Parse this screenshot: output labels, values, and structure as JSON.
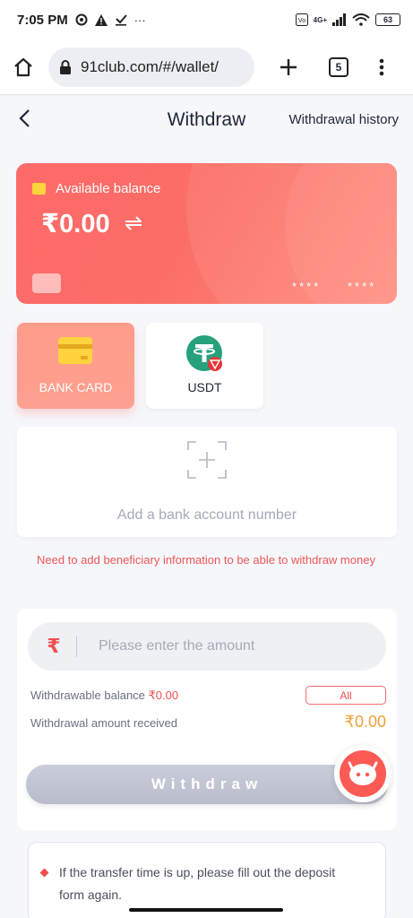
{
  "status_bar": {
    "time": "7:05 PM",
    "network": "4G+",
    "battery": "63",
    "notification_icons": [
      "sync-icon",
      "warning-icon",
      "check-icon",
      "more-dots-icon"
    ]
  },
  "browser": {
    "url": "91club.com/#/wallet/",
    "tab_count": "5",
    "icons": [
      "home-icon",
      "lock-icon",
      "new-tab-plus-icon",
      "tabs-icon",
      "overflow-menu-icon"
    ]
  },
  "header": {
    "title": "Withdraw",
    "history_link": "Withdrawal history"
  },
  "balance_card": {
    "label": "Available balance",
    "amount": "₹0.00",
    "masked_1": "****",
    "masked_2": "****",
    "colors": {
      "card_start": "#ff6a6a",
      "card_end": "#ff8a7a"
    }
  },
  "methods": [
    {
      "label": "BANK CARD",
      "icon": "bank-card-icon",
      "selected": true
    },
    {
      "label": "USDT",
      "icon": "tether-icon",
      "selected": false
    }
  ],
  "add_account": {
    "text": "Add a bank account number"
  },
  "notice": "Need to add beneficiary information to be able to withdraw money",
  "amount_panel": {
    "currency_symbol": "₹",
    "placeholder": "Please enter the amount",
    "withdrawable_label": "Withdrawable balance ",
    "withdrawable_value": "₹0.00",
    "all_button": "All",
    "received_label": "Withdrawal amount received",
    "received_value": "₹0.00",
    "submit_button": "Withdraw"
  },
  "instructions": [
    "If the transfer time is up, please fill out the deposit form again."
  ],
  "colors": {
    "accent_red": "#f04e4e",
    "accent_orange": "#f0a33a",
    "disabled_button": "#c4c7d4"
  }
}
